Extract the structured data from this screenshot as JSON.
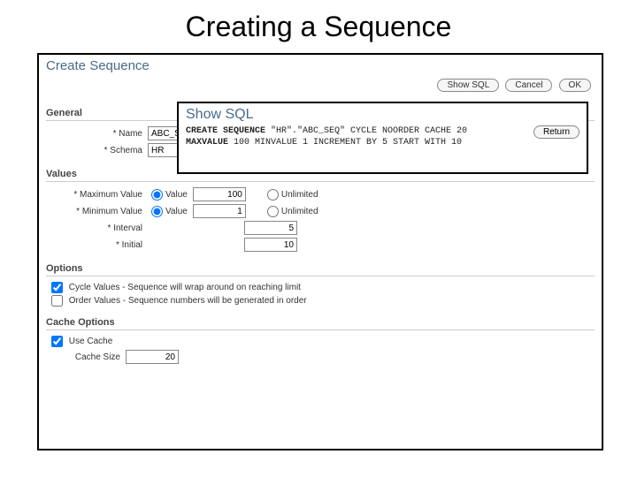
{
  "slide": {
    "title": "Creating a Sequence"
  },
  "page": {
    "title": "Create Sequence",
    "buttons": {
      "show_sql": "Show SQL",
      "cancel": "Cancel",
      "ok": "OK"
    }
  },
  "general": {
    "heading": "General",
    "name_label": "* Name",
    "name_value": "ABC_SEQ",
    "schema_label": "* Schema",
    "schema_value": "HR"
  },
  "values": {
    "heading": "Values",
    "radio_value": "Value",
    "radio_unlimited": "Unlimited",
    "max_label": "* Maximum Value",
    "max_value": "100",
    "min_label": "* Minimum Value",
    "min_value": "1",
    "interval_label": "* Interval",
    "interval_value": "5",
    "initial_label": "* Initial",
    "initial_value": "10"
  },
  "options": {
    "heading": "Options",
    "cycle": "Cycle Values - Sequence will wrap around on reaching limit",
    "order": "Order Values - Sequence numbers will be generated in order"
  },
  "cache": {
    "heading": "Cache Options",
    "use_cache": "Use Cache",
    "size_label": "Cache Size",
    "size_value": "20"
  },
  "overlay": {
    "title": "Show SQL",
    "return_btn": "Return",
    "sql_1a": "CREATE SEQUENCE",
    "sql_1b": " \"HR\".\"ABC_SEQ\" CYCLE NOORDER CACHE 20 ",
    "sql_2a": "MAXVALUE",
    "sql_2b": " 100 MINVALUE 1 INCREMENT BY 5 START WITH 10"
  }
}
